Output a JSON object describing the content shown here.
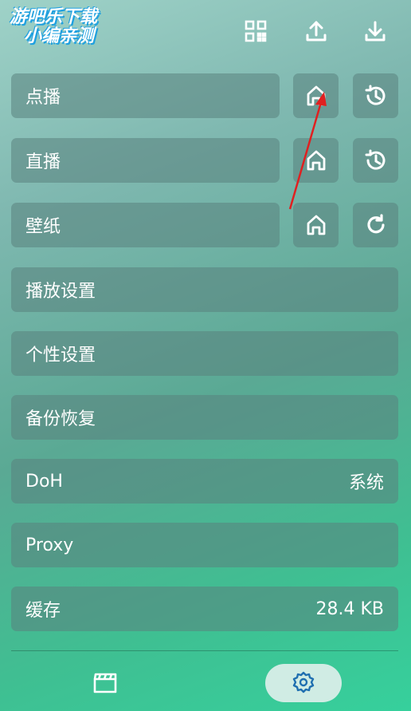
{
  "watermark": {
    "line1": "游吧乐下载",
    "line2": "小编亲测"
  },
  "topbar": {
    "icons": [
      "qrcode-icon",
      "upload-icon",
      "download-icon"
    ]
  },
  "rows": {
    "vod": {
      "label": "点播",
      "icons": [
        "home-icon",
        "history-icon"
      ]
    },
    "live": {
      "label": "直播",
      "icons": [
        "home-icon",
        "history-icon"
      ]
    },
    "wallpaper": {
      "label": "壁纸",
      "icons": [
        "home-icon",
        "refresh-icon"
      ]
    },
    "playback": {
      "label": "播放设置"
    },
    "personal": {
      "label": "个性设置"
    },
    "backup": {
      "label": "备份恢复"
    },
    "doh": {
      "label": "DoH",
      "value": "系统"
    },
    "proxy": {
      "label": "Proxy"
    },
    "cache": {
      "label": "缓存",
      "value": "28.4 KB"
    }
  },
  "bottom_nav": {
    "items": [
      "film-icon",
      "settings-icon"
    ],
    "active": "settings-icon"
  },
  "colors": {
    "annotation_arrow": "#e02020",
    "nav_active": "#1f6fb0"
  }
}
